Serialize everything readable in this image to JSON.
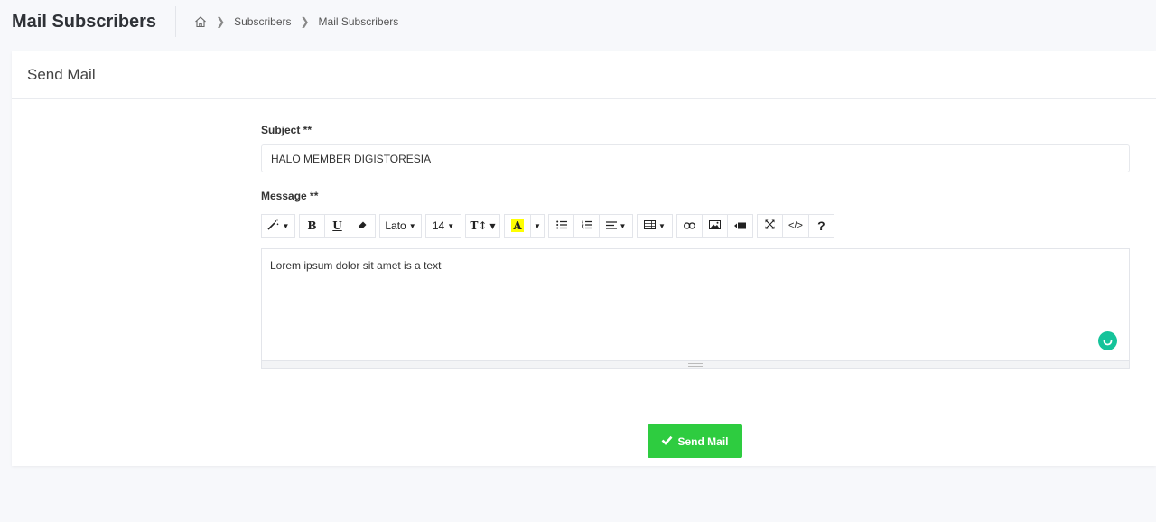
{
  "header": {
    "title": "Mail Subscribers",
    "breadcrumb": [
      "Subscribers",
      "Mail Subscribers"
    ]
  },
  "card": {
    "title": "Send Mail",
    "subject": {
      "label": "Subject **",
      "value": "HALO MEMBER DIGISTORESIA"
    },
    "message": {
      "label": "Message **",
      "content": "Lorem ipsum dolor sit amet is a text"
    },
    "toolbar": {
      "font_name": "Lato",
      "font_size": "14",
      "highlight_letter": "A",
      "help": "?"
    },
    "submit_label": "Send Mail"
  },
  "colors": {
    "accent_green": "#2ecc40",
    "grammarly": "#15c39a"
  }
}
